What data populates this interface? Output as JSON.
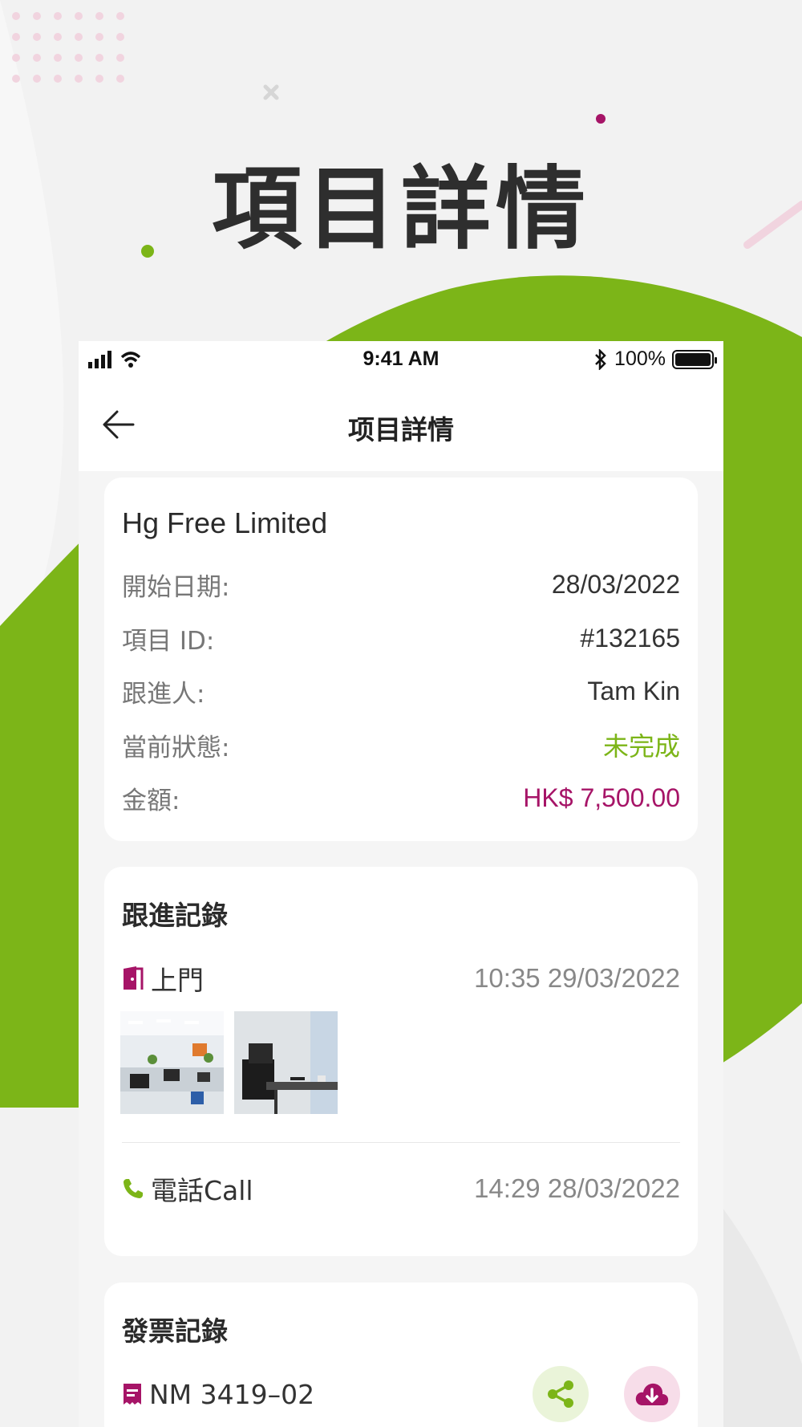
{
  "hero": {
    "title": "項目詳情"
  },
  "status_bar": {
    "time": "9:41 AM",
    "battery": "100%"
  },
  "nav": {
    "title": "项目詳情"
  },
  "project": {
    "company": "Hg Free Limited",
    "fields": [
      {
        "label": "開始日期:",
        "value": "28/03/2022",
        "color": "#333333"
      },
      {
        "label": "項目 ID:",
        "value": "#132165",
        "color": "#333333"
      },
      {
        "label": "跟進人:",
        "value": "Tam Kin",
        "color": "#333333"
      },
      {
        "label": "當前狀態:",
        "value": "未完成",
        "color": "#7cb518"
      },
      {
        "label": "金額:",
        "value": "HK$ 7,500.00",
        "color": "#a61467"
      }
    ]
  },
  "follow_up": {
    "title": "跟進記錄",
    "records": [
      {
        "icon": "door-icon",
        "label": "上門",
        "time": "10:35 29/03/2022"
      },
      {
        "icon": "phone-icon",
        "label": "電話Call",
        "time": "14:29 28/03/2022"
      }
    ]
  },
  "invoices": {
    "title": "發票記錄",
    "items": [
      {
        "icon": "receipt-icon",
        "number": "NM 3419–02"
      }
    ]
  },
  "colors": {
    "brand_green": "#7cb518",
    "accent_magenta": "#a61467",
    "green_light_bg": "#eaf4d9",
    "magenta_light_bg": "#f7dde9"
  }
}
